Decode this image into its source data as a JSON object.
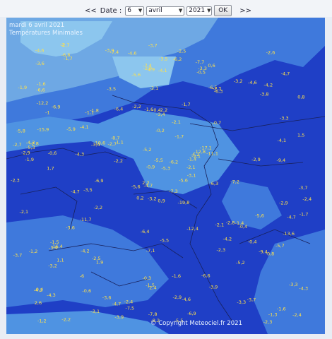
{
  "controls": {
    "prev_label": "<<",
    "date_label": "Date :",
    "day": "6",
    "month": "avril",
    "year": "2021",
    "ok_label": "OK",
    "next_label": ">>"
  },
  "map": {
    "date_caption": "mardi 6 avril 2021",
    "title_caption": "Températures Minimales",
    "copyright": "© Copyright Meteociel.fr 2021",
    "colors": {
      "sea": "#6ea8e4",
      "cold": "#1f3fc6",
      "cool": "#3f79dc",
      "mild": "#4f93e2",
      "lightest": "#8cc6ee",
      "border": "#18205a",
      "label": "#ffe14a"
    },
    "station_values": [
      "0,9",
      "-1",
      "-4,7",
      "-0,4",
      "-1,4",
      "1,9",
      "0,6",
      "2,2",
      "-2,3",
      "-5,6",
      "-1,7",
      "-2,4",
      "1,7",
      "0,8",
      "0,2",
      "-0,7",
      "-2,2",
      "-1,6",
      "-1,7",
      "1,1",
      "1,1",
      "2,6",
      "-0,6",
      "-0,4",
      "-2,1",
      "-0,4",
      "-6,9",
      "-4,9",
      "-1,9",
      "-2,1",
      "1,5",
      "2,2",
      "-0,3",
      "-0,9",
      "-1,8",
      "-3,2",
      "-2,5",
      "-1,3",
      "-3,3",
      "-1,4",
      "-2,5",
      "-2,7",
      "-4,3",
      "-2,3",
      "-3,1",
      "-2,7",
      "-2,1",
      "-1,2",
      "-2,4",
      "-3,1",
      "-3,2",
      "-3,3",
      "-1,9",
      "-4,2",
      "-3,9",
      "-6",
      "-6,8",
      "-4,6",
      "-1,6",
      "-4,2",
      "-3,5",
      "-6,9",
      "-2,8",
      "-4,1",
      "-4,6",
      "-2",
      "-3,3",
      "-5,6",
      "-5,5",
      "-3,7",
      "-7,1",
      "-4,7",
      "-2,8",
      "-3,4",
      "-4,2",
      "-3,6",
      "-5,9",
      "-2,1",
      "-5,2",
      "-2,9",
      "-6,2",
      "-4,3",
      "-6,3",
      "-13,6",
      "-7,8",
      "-9,4",
      "-5,5",
      "-3,7",
      "-5,5",
      "-6,6",
      "-7,4",
      "-2,4",
      "-11,1",
      "-5,2",
      "-5,3",
      "-5,7",
      "-5,3",
      "-8,2",
      "-6,5",
      "-6,3",
      "-4,7",
      "-3,9",
      "-3,7",
      "-2,9",
      "-3,6",
      "-4,2",
      "-3,6",
      "-4,2",
      "-3,8",
      "-2,2",
      "-2,9",
      "-6,6",
      "-3,4",
      "-5,6",
      "-7,4",
      "-1,2",
      "-3,2",
      "-4,7",
      "-2,2",
      "-4,6",
      "-3,9",
      "-2,6",
      "-2,1",
      "-6,4",
      "-7,2",
      "-11,7",
      "-1,6",
      "-7,5",
      "-2,9",
      "-12,2",
      "-16,4",
      "-6,9",
      "-10,6",
      "-3,5",
      "-4,7",
      "-0,4",
      "-2,2",
      "-1,5",
      "-1,7",
      "-8,7",
      "-19,8",
      "-0,6",
      "-9,4",
      "-7,3",
      "-12,8",
      "-1,6",
      "-2,4",
      "-3,3",
      "-1,5",
      "-2,9",
      "-4,1",
      "-1,1",
      "-4,3",
      "-3,9",
      "-5,6",
      "-6,2",
      "-2,1",
      "-0,2",
      "-3,5",
      "-1,7",
      "-12,4",
      "-4,1",
      "-2,3",
      "-3,7",
      "-0,5",
      "-15,9",
      "-6,4",
      "-4,3",
      "-2,7",
      "-2,3",
      "-0,8",
      "-4,6",
      "-5,8",
      "-7,7",
      "-17,1"
    ]
  }
}
